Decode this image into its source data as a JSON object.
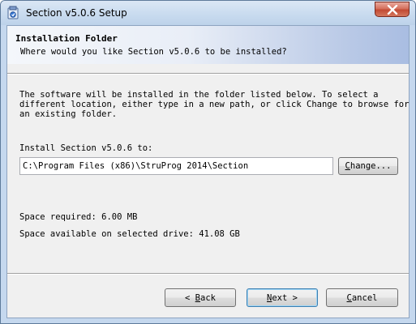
{
  "window": {
    "title": "Section v5.0.6 Setup",
    "icon": "installer-icon",
    "close_icon": "close-icon"
  },
  "header": {
    "title": "Installation Folder",
    "subtitle": "Where would you like Section v5.0.6 to be installed?"
  },
  "body": {
    "description_lines": [
      "The software will be installed in the folder listed below. To select a",
      "different location, either type in a new path, or click Change to browse for",
      "an existing folder."
    ],
    "install_label": "Install Section v5.0.6 to:",
    "install_path": "C:\\Program Files (x86)\\StruProg 2014\\Section",
    "change_button": {
      "prefix": "",
      "accel": "C",
      "rest": "hange..."
    },
    "space_required": "Space required: 6.00 MB",
    "space_available": "Space available on selected drive: 41.08 GB"
  },
  "footer": {
    "back_button": {
      "prefix": "< ",
      "accel": "B",
      "rest": "ack"
    },
    "next_button": {
      "prefix": "",
      "accel": "N",
      "rest": "ext >"
    },
    "cancel_button": {
      "prefix": "",
      "accel": "C",
      "rest": "ancel"
    }
  },
  "colors": {
    "close_button": "#c24a33",
    "header_gradient_end": "#a9bde2",
    "default_button_border": "#3c7fb1"
  }
}
